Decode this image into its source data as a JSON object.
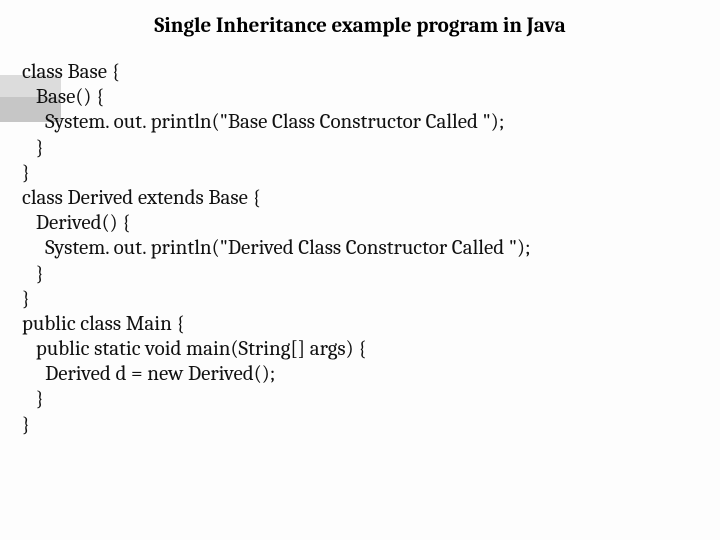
{
  "title": "Single Inheritance example program in Java",
  "code": {
    "l1": "class Base {",
    "l2": "   Base() {",
    "l3": "     System. out. println(\"Base Class Constructor Called \");",
    "l4": "   }",
    "l5": "}",
    "l6": "class Derived extends Base {",
    "l7": "   Derived() {",
    "l8": "     System. out. println(\"Derived Class Constructor Called \");",
    "l9": "   }",
    "l10": "}",
    "l11": "public class Main {",
    "l12": "   public static void main(String[] args) {",
    "l13": "     Derived d = new Derived();",
    "l14": "   }",
    "l15": "}"
  }
}
